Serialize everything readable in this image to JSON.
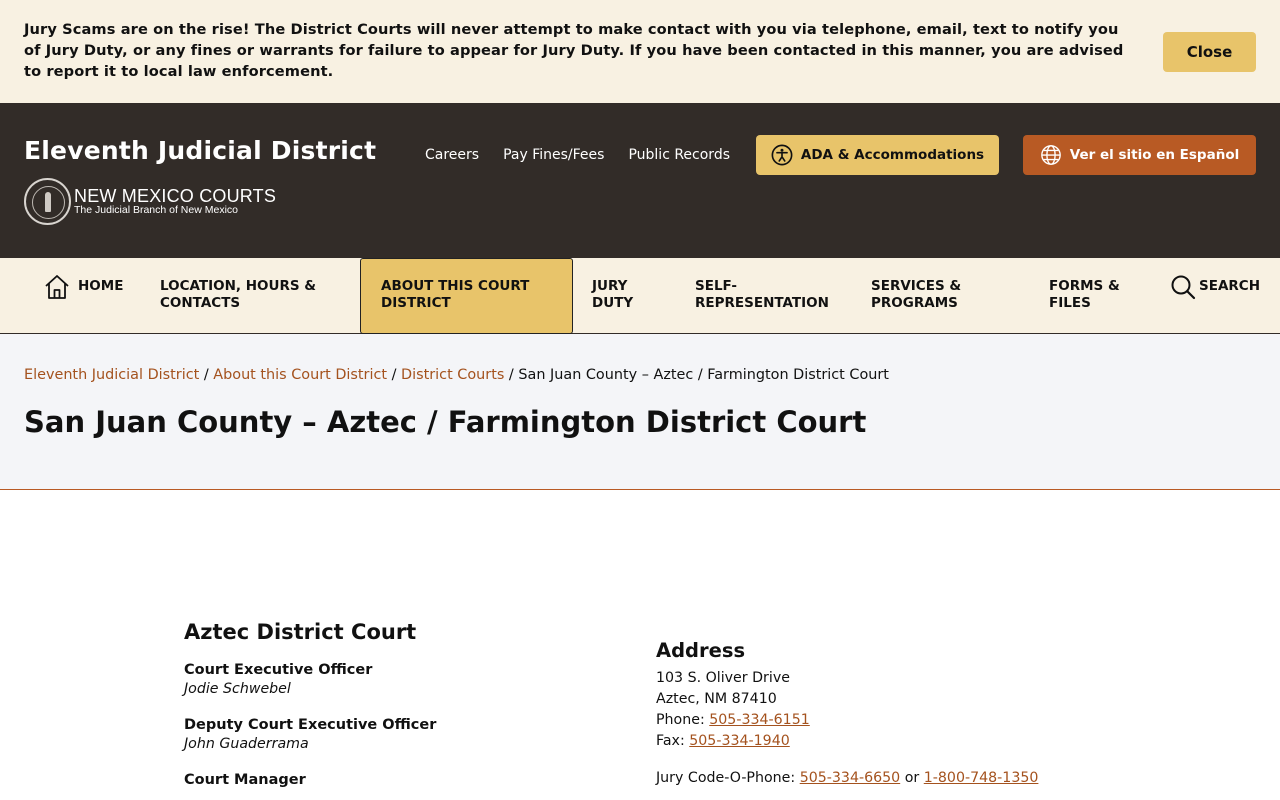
{
  "alert": {
    "message": "Jury Scams are on the rise! The District Courts will never attempt to make contact with you via telephone, email, text to notify you of Jury Duty, or any fines or warrants for failure to appear for Jury Duty. If you have been contacted in this manner, you are advised to report it to local law enforcement.",
    "close_label": "Close"
  },
  "header": {
    "site_title": "Eleventh Judicial District",
    "logo_main": "NEW MEXICO COURTS",
    "logo_sub": "The Judicial Branch of New Mexico",
    "top_links": [
      "Careers",
      "Pay Fines/Fees",
      "Public Records"
    ],
    "ada_label": "ADA & Accommodations",
    "spanish_label": "Ver el sitio en Español"
  },
  "nav": {
    "home": "HOME",
    "location": "LOCATION, HOURS & CONTACTS",
    "about": "ABOUT THIS COURT DISTRICT",
    "jury": "JURY DUTY",
    "self_rep": "SELF-REPRESENTATION",
    "services": "SERVICES & PROGRAMS",
    "forms": "FORMS & FILES",
    "search": "SEARCH"
  },
  "breadcrumb": {
    "items": [
      "Eleventh Judicial District",
      "About this Court District",
      "District Courts"
    ],
    "current": "San Juan County – Aztec / Farmington District Court",
    "separator": "/"
  },
  "page_title": "San Juan County – Aztec / Farmington District Court",
  "court": {
    "name": "Aztec District Court",
    "staff": [
      {
        "role": "Court Executive Officer",
        "name": "Jodie Schwebel"
      },
      {
        "role": "Deputy Court Executive Officer",
        "name": "John Guaderrama"
      },
      {
        "role": "Court Manager",
        "name": ""
      }
    ]
  },
  "address": {
    "heading": "Address",
    "street": "103 S. Oliver Drive",
    "city": "Aztec, NM 87410",
    "phone_label": "Phone:",
    "phone": "505-334-6151",
    "fax_label": "Fax:",
    "fax": "505-334-1940",
    "jury_label": "Jury Code-O-Phone:",
    "jury_phone1": "505-334-6650",
    "jury_or": "or",
    "jury_phone2": "1-800-748-1350"
  },
  "colors": {
    "banner_bg": "#f8f1e2",
    "header_bg": "#322c28",
    "gold": "#e8c46a",
    "rust": "#b85a24",
    "link": "#a4521e"
  },
  "icons": [
    "accessibility-icon",
    "globe-icon",
    "home-icon",
    "search-icon",
    "seal-logo"
  ]
}
